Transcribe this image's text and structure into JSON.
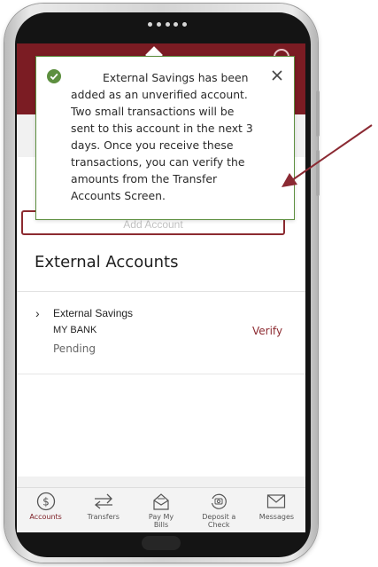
{
  "toast": {
    "message": "External Savings has been added as an unverified account. Two small transactions will be sent to this account in the next 3 days. Once you receive these transactions, you can verify the amounts from the Transfer Accounts Screen."
  },
  "accounts": {
    "add_button_label": "Add Account",
    "section_title": "External Accounts",
    "items": [
      {
        "name": "External Savings",
        "bank": "MY BANK",
        "status": "Pending",
        "action": "Verify"
      }
    ]
  },
  "tabs": [
    {
      "label": "Accounts",
      "icon": "dollar-circle-icon",
      "active": true
    },
    {
      "label": "Transfers",
      "icon": "transfer-arrows-icon",
      "active": false
    },
    {
      "label": "Pay My Bills",
      "icon": "pay-bills-icon",
      "active": false
    },
    {
      "label": "Deposit a Check",
      "icon": "camera-refresh-icon",
      "active": false
    },
    {
      "label": "Messages",
      "icon": "envelope-icon",
      "active": false
    }
  ],
  "colors": {
    "brand": "#7b1c23",
    "success": "#5d8f3f",
    "annotation_arrow": "#8b2a33"
  }
}
